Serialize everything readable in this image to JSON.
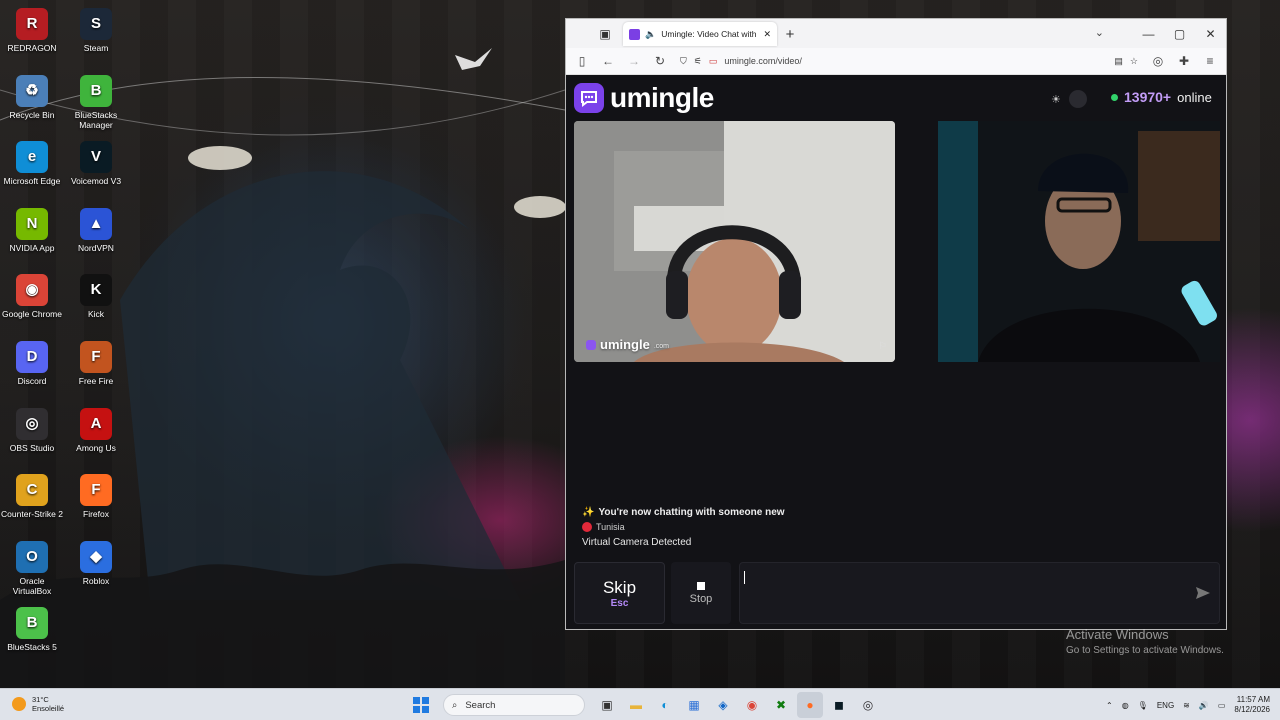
{
  "desktop": {
    "icons": [
      {
        "label": "REDRAGON",
        "color": "#b51d22",
        "glyph": "R"
      },
      {
        "label": "Steam",
        "color": "#1c2838",
        "glyph": "S"
      },
      {
        "label": "Recycle Bin",
        "color": "#4b7fb8",
        "glyph": "♻"
      },
      {
        "label": "BlueStacks Manager",
        "color": "#3fb43c",
        "glyph": "B"
      },
      {
        "label": "Microsoft Edge",
        "color": "#0f8ed6",
        "glyph": "e"
      },
      {
        "label": "Voicemod V3",
        "color": "#0a1b24",
        "glyph": "V"
      },
      {
        "label": "NVIDIA App",
        "color": "#76b900",
        "glyph": "N"
      },
      {
        "label": "NordVPN",
        "color": "#2b54d6",
        "glyph": "▲"
      },
      {
        "label": "Google Chrome",
        "color": "#db4437",
        "glyph": "◉"
      },
      {
        "label": "Kick",
        "color": "#111111",
        "glyph": "K"
      },
      {
        "label": "Discord",
        "color": "#5865f2",
        "glyph": "D"
      },
      {
        "label": "Free Fire",
        "color": "#c2541f",
        "glyph": "F"
      },
      {
        "label": "OBS Studio",
        "color": "#302e31",
        "glyph": "◎"
      },
      {
        "label": "Among Us",
        "color": "#c51111",
        "glyph": "A"
      },
      {
        "label": "Counter-Strike 2",
        "color": "#e0a21d",
        "glyph": "C"
      },
      {
        "label": "Firefox",
        "color": "#ff6b22",
        "glyph": "F"
      },
      {
        "label": "Oracle VirtualBox",
        "color": "#1f6fb2",
        "glyph": "O"
      },
      {
        "label": "Roblox",
        "color": "#2b6ee0",
        "glyph": "◆"
      },
      {
        "label": "BlueStacks 5",
        "color": "#4cc14a",
        "glyph": "B"
      }
    ]
  },
  "browser": {
    "tab_title": "Umingle: Video Chat with S",
    "url": "umingle.com/video/",
    "new_tab": "+",
    "tab_close": "✕"
  },
  "site": {
    "logo_text": "umingle",
    "online_count": "13970+",
    "online_label": "online",
    "watermark_text": "umingle",
    "watermark_suffix": ".com",
    "status_new": "You're now chatting with someone new",
    "status_sparkle": "✨",
    "country": "Tunisia",
    "camera_notice": "Virtual Camera Detected",
    "skip_label": "Skip",
    "skip_key": "Esc",
    "stop_label": "Stop",
    "message_value": "",
    "accent_color": "#7b42ea"
  },
  "watermark": {
    "line1": "Activate Windows",
    "line2": "Go to Settings to activate Windows."
  },
  "taskbar": {
    "weather_temp": "31°C",
    "weather_desc": "Ensoleillé",
    "search_placeholder": "Search",
    "language": "ENG",
    "time": "11:57 AM",
    "date": "8/12/2026"
  }
}
